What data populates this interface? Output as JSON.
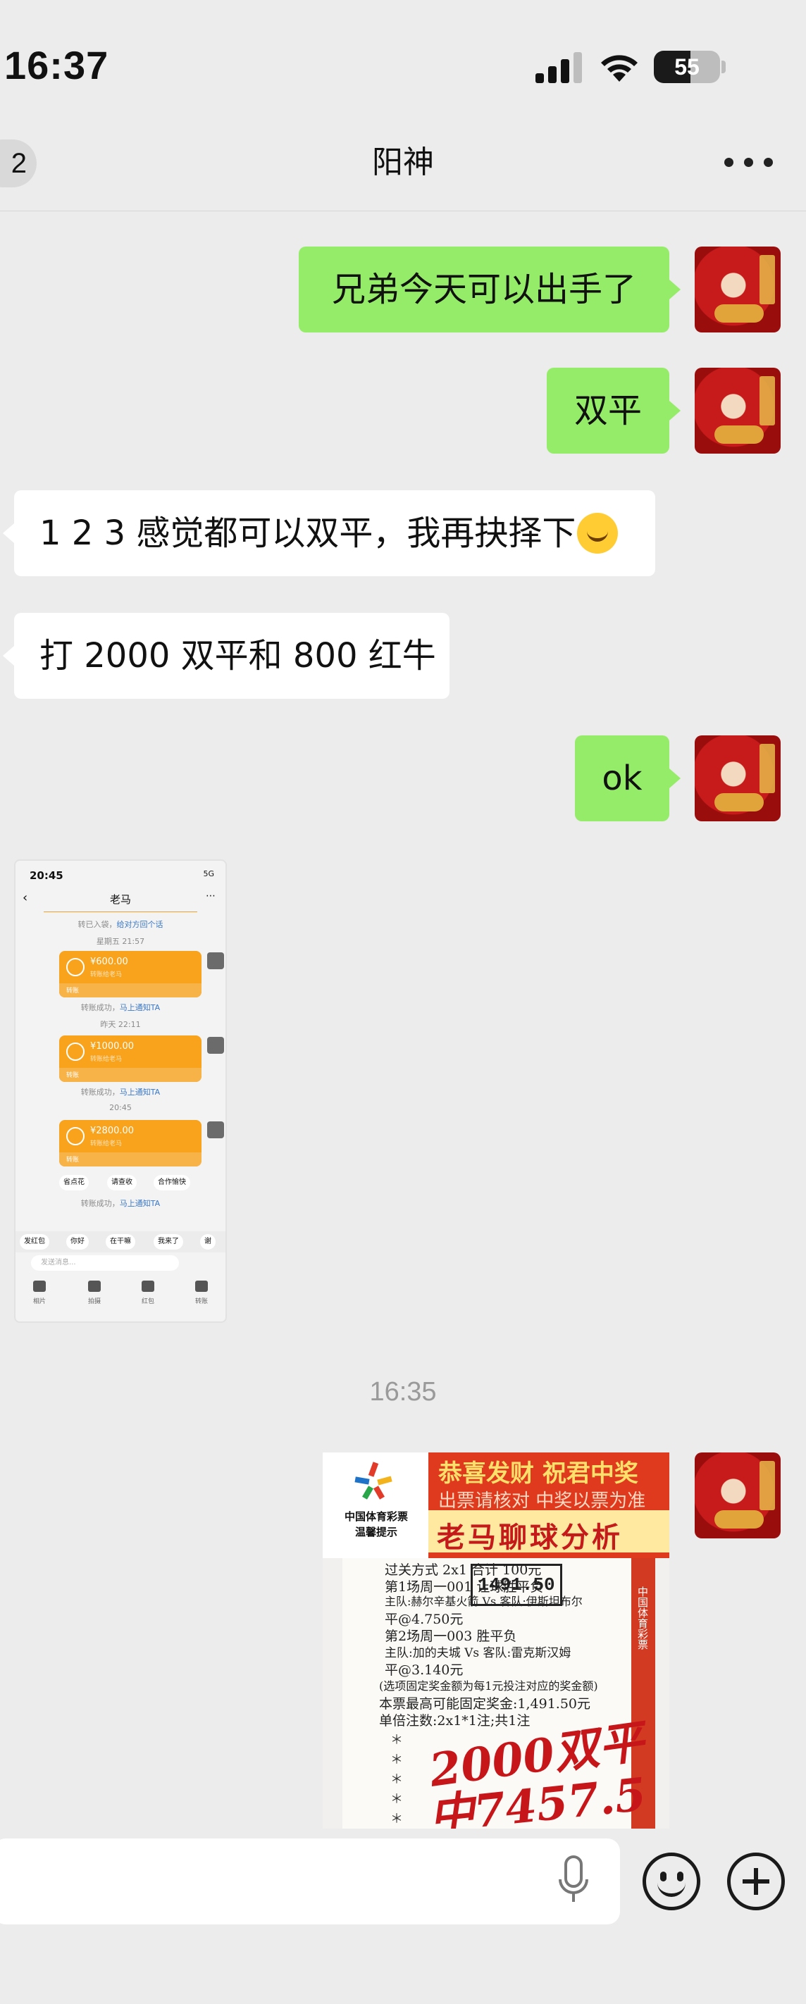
{
  "status_bar": {
    "time": "16:37",
    "battery_level": "55",
    "battery_fraction": 0.55
  },
  "nav": {
    "back_badge": "2",
    "title": "阳神",
    "more_icon": "more-horizontal-icon"
  },
  "messages": [
    {
      "side": "out",
      "text": "兄弟今天可以出手了"
    },
    {
      "side": "out",
      "text": "双平"
    },
    {
      "side": "in",
      "text": "1 2 3 感觉都可以双平，我再抉择下"
    },
    {
      "side": "in",
      "text": "打 2000 双平和 800 红牛"
    },
    {
      "side": "out",
      "text": "ok"
    }
  ],
  "shared_screenshot": {
    "status_time": "20:45",
    "status_right": "5G",
    "title": "老马",
    "system_notes": [
      {
        "prefix": "转已入袋，",
        "link": "给对方回个话"
      },
      {
        "prefix": "星期五 21:57",
        "link": ""
      },
      {
        "prefix": "转账成功，",
        "link": "马上通知TA"
      },
      {
        "prefix": "昨天 22:11",
        "link": ""
      },
      {
        "prefix": "转账成功，",
        "link": "马上通知TA"
      },
      {
        "prefix": "20:45",
        "link": ""
      },
      {
        "prefix": "转账成功，",
        "link": "马上通知TA"
      }
    ],
    "transfers": [
      {
        "amount": "¥600.00",
        "sub": "转账给老马",
        "label": "转账"
      },
      {
        "amount": "¥1000.00",
        "sub": "转账给老马",
        "label": "转账"
      },
      {
        "amount": "¥2800.00",
        "sub": "转账给老马",
        "label": "转账"
      }
    ],
    "chips": [
      "省点花",
      "请查收",
      "合作愉快"
    ],
    "quick_replies": [
      "发红包",
      "你好",
      "在干嘛",
      "我来了",
      "谢"
    ],
    "input_placeholder": "发送消息...",
    "tools": [
      "相片",
      "拍摄",
      "红包",
      "转账"
    ]
  },
  "timestamp": "16:35",
  "ticket": {
    "logo_line1": "中国体育彩票",
    "logo_line2": "温馨提示",
    "banner_line1": "恭喜发财 祝君中奖",
    "banner_line2": "出票请核对 中奖以票为准",
    "banner_line3": "老马聊球分析",
    "stamp": "1491.50",
    "lines": [
      "过关方式 2x1       合计 100元",
      "第1场周一001 让球胜平负",
      "主队:赫尔辛基火箭 Vs 客队:伊斯坦布尔",
      "平@4.750元",
      "第2场周一003 胜平负",
      "主队:加的夫城 Vs 客队:雷克斯汉姆",
      "平@3.140元",
      "(选项固定奖金额为每1元投注对应的奖金额)",
      "本票最高可能固定奖金:1,491.50元",
      "单倍注数:2x1*1注;共1注"
    ],
    "side_text": "中国体育彩票",
    "handwriting_1": "2000双平",
    "handwriting_2": "中7457.5"
  },
  "input_bar": {
    "mic_icon": "microphone-icon",
    "emoji_icon": "emoji-smile-icon",
    "plus_icon": "plus-circle-icon"
  },
  "colors": {
    "outgoing_bubble": "#95ec69",
    "incoming_bubble": "#ffffff",
    "background": "#ececec",
    "transfer_card": "#f9a21b"
  }
}
